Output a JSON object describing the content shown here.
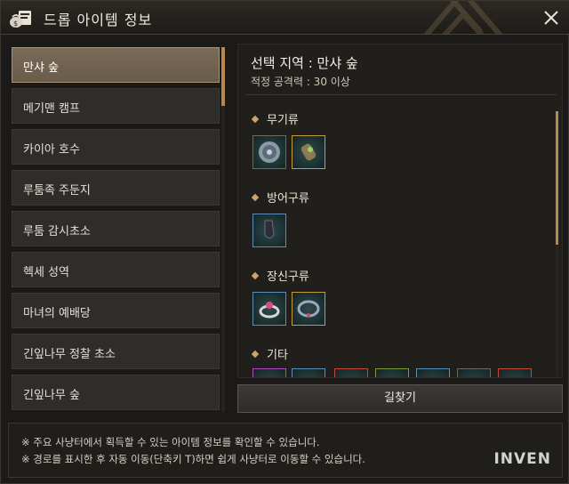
{
  "window": {
    "title": "드롭 아이템 정보",
    "title_icon": "item-bag-icon",
    "close_icon": "close-icon"
  },
  "regions": [
    {
      "label": "만샤 숲",
      "active": true
    },
    {
      "label": "메기맨 캠프"
    },
    {
      "label": "카이아 호수"
    },
    {
      "label": "루툼족 주둔지"
    },
    {
      "label": "루툼 감시초소"
    },
    {
      "label": "헥세 성역"
    },
    {
      "label": "마녀의 예배당"
    },
    {
      "label": "긴잎나무 정찰 초소"
    },
    {
      "label": "긴잎나무 숲"
    }
  ],
  "detail": {
    "title": "선택 지역 : 만샤 숲",
    "subtitle": "적정 공격력 : 30 이상",
    "categories": {
      "weapon": {
        "label": "무기류",
        "items": [
          "shield-icon",
          "gauntlet-icon"
        ]
      },
      "armor": {
        "label": "방어구류",
        "items": [
          "gloves-icon"
        ]
      },
      "accessory": {
        "label": "장신구류",
        "items": [
          "ring-icon",
          "necklace-icon"
        ]
      },
      "other": {
        "label": "기타"
      }
    }
  },
  "route_button": {
    "label": "길찾기"
  },
  "notice": {
    "line1": "※ 주요 사냥터에서 획득할 수 있는 아이템 정보를 확인할 수 있습니다.",
    "line2": "※ 경로를 표시한 후 자동 이동(단축키 T)하면 쉽게 사냥터로 이동할 수 있습니다."
  },
  "watermark": "INVEN",
  "colors": {
    "accent": "#b7874d",
    "active_item": "#6f604e",
    "slot_gold": "#c79a3a"
  }
}
